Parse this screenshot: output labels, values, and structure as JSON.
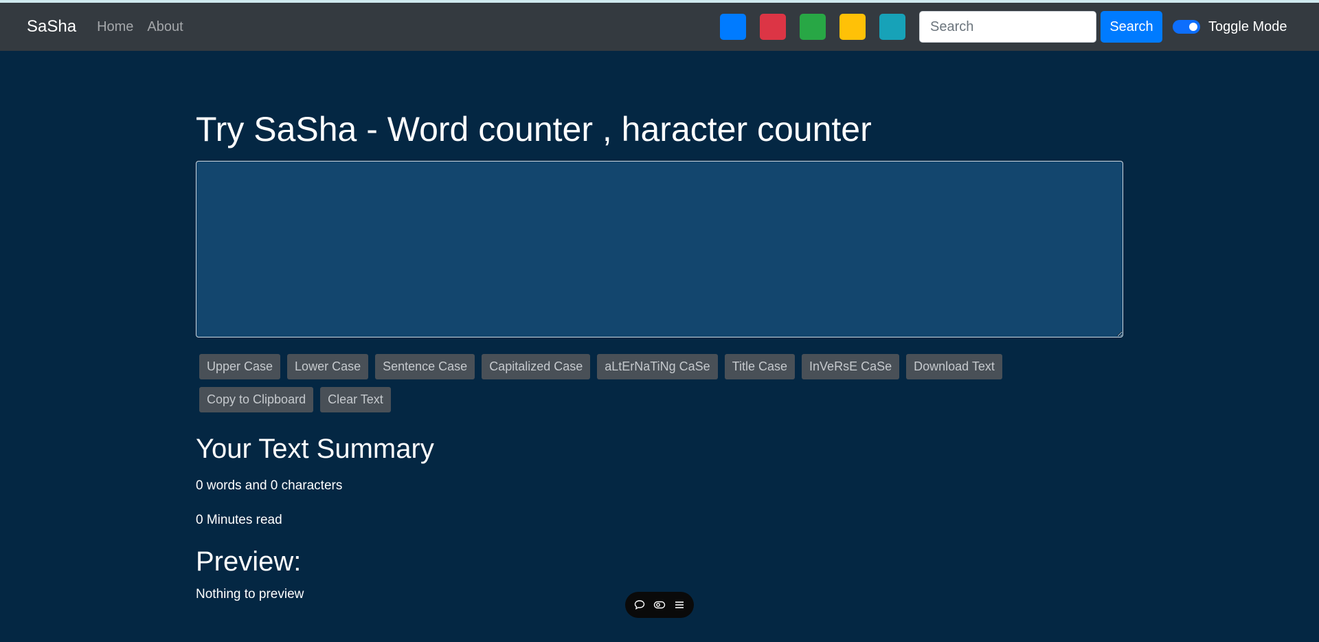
{
  "navbar": {
    "brand": "SaSha",
    "links": [
      "Home",
      "About"
    ],
    "swatches": [
      {
        "color": "#007bff"
      },
      {
        "color": "#dc3545"
      },
      {
        "color": "#28a745"
      },
      {
        "color": "#ffc107"
      },
      {
        "color": "#17a2b8"
      }
    ],
    "search_placeholder": "Search",
    "search_button": "Search",
    "toggle_label": "Toggle Mode",
    "toggle_on": true
  },
  "main": {
    "title": "Try SaSha - Word counter , haracter counter",
    "textarea_value": "",
    "buttons": [
      "Upper Case",
      "Lower Case",
      "Sentence Case",
      "Capitalized Case",
      "aLtErNaTiNg CaSe",
      "Title Case",
      "InVeRsE CaSe",
      "Download Text",
      "Copy to Clipboard",
      "Clear Text"
    ],
    "summary_title": "Your Text Summary",
    "summary_text": "0 words and 0 characters",
    "minutes_text": "0 Minutes read",
    "preview_title": "Preview:",
    "preview_text": "Nothing to preview"
  },
  "floating_bar": {
    "icons": [
      "chat-bubble-icon",
      "toggle-view-icon",
      "menu-icon"
    ]
  }
}
